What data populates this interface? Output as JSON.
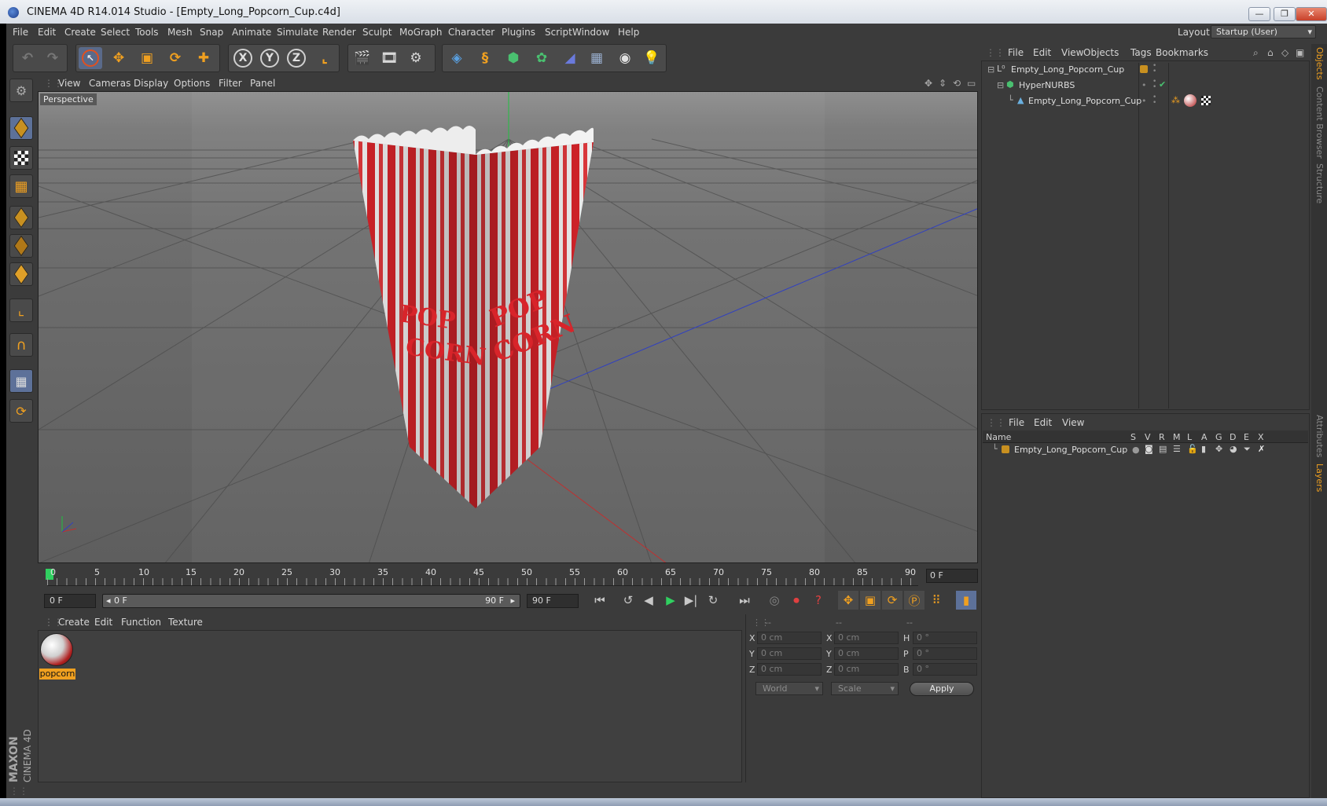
{
  "window": {
    "title": "CINEMA 4D R14.014 Studio - [Empty_Long_Popcorn_Cup.c4d]",
    "buttons": {
      "minimize": "—",
      "maximize": "❐",
      "close": "✕"
    }
  },
  "menubar": {
    "items": [
      "File",
      "Edit",
      "Create",
      "Select",
      "Tools",
      "Mesh",
      "Snap",
      "Animate",
      "Simulate",
      "Render",
      "Sculpt",
      "MoGraph",
      "Character",
      "Plugins",
      "Script",
      "Window",
      "Help"
    ],
    "layout_label": "Layout:",
    "layout_value": "Startup (User)"
  },
  "toolbar": {
    "axis_x": "X",
    "axis_y": "Y",
    "axis_z": "Z"
  },
  "viewport": {
    "menu": [
      "View",
      "Cameras",
      "Display",
      "Options",
      "Filter",
      "Panel"
    ],
    "camera_label": "Perspective",
    "cup_text": [
      "POP",
      "CORN"
    ]
  },
  "timeline": {
    "ticks": [
      "0",
      "5",
      "10",
      "15",
      "20",
      "25",
      "30",
      "35",
      "40",
      "45",
      "50",
      "55",
      "60",
      "65",
      "70",
      "75",
      "80",
      "85",
      "90"
    ],
    "current_frame": "0 F",
    "start_field": "0 F",
    "range_start": "0 F",
    "range_end": "90 F",
    "end_field": "90 F"
  },
  "material_manager": {
    "menu": [
      "Create",
      "Edit",
      "Function",
      "Texture"
    ],
    "materials": [
      {
        "name": "popcorn"
      }
    ]
  },
  "coordinates": {
    "headers": [
      "--",
      "--",
      "--"
    ],
    "rows": [
      {
        "l1": "X",
        "v1": "0 cm",
        "l2": "X",
        "v2": "0 cm",
        "l3": "H",
        "v3": "0 °"
      },
      {
        "l1": "Y",
        "v1": "0 cm",
        "l2": "Y",
        "v2": "0 cm",
        "l3": "P",
        "v3": "0 °"
      },
      {
        "l1": "Z",
        "v1": "0 cm",
        "l2": "Z",
        "v2": "0 cm",
        "l3": "B",
        "v3": "0 °"
      }
    ],
    "mode_select": "World",
    "size_select": "Scale",
    "apply_label": "Apply"
  },
  "object_manager": {
    "menu": [
      "File",
      "Edit",
      "View",
      "Objects",
      "Tags",
      "Bookmarks"
    ],
    "objects": [
      {
        "name": "Empty_Long_Popcorn_Cup"
      },
      {
        "name": "HyperNURBS"
      },
      {
        "name": "Empty_Long_Popcorn_Cup"
      }
    ]
  },
  "layer_manager": {
    "menu": [
      "File",
      "Edit",
      "View"
    ],
    "columns": [
      "Name",
      "S",
      "V",
      "R",
      "M",
      "L",
      "A",
      "G",
      "D",
      "E",
      "X"
    ],
    "layers": [
      {
        "name": "Empty_Long_Popcorn_Cup"
      }
    ]
  },
  "side_tabs": [
    "Objects",
    "Content Browser",
    "Structure",
    "Attributes",
    "Layers"
  ],
  "branding": {
    "line1": "MAXON",
    "line2": "CINEMA 4D"
  },
  "colors": {
    "accent": "#f0a020",
    "panel_bg": "#3b3b3b",
    "selected_blue": "#5d7199",
    "cup_red": "#d8242a"
  }
}
